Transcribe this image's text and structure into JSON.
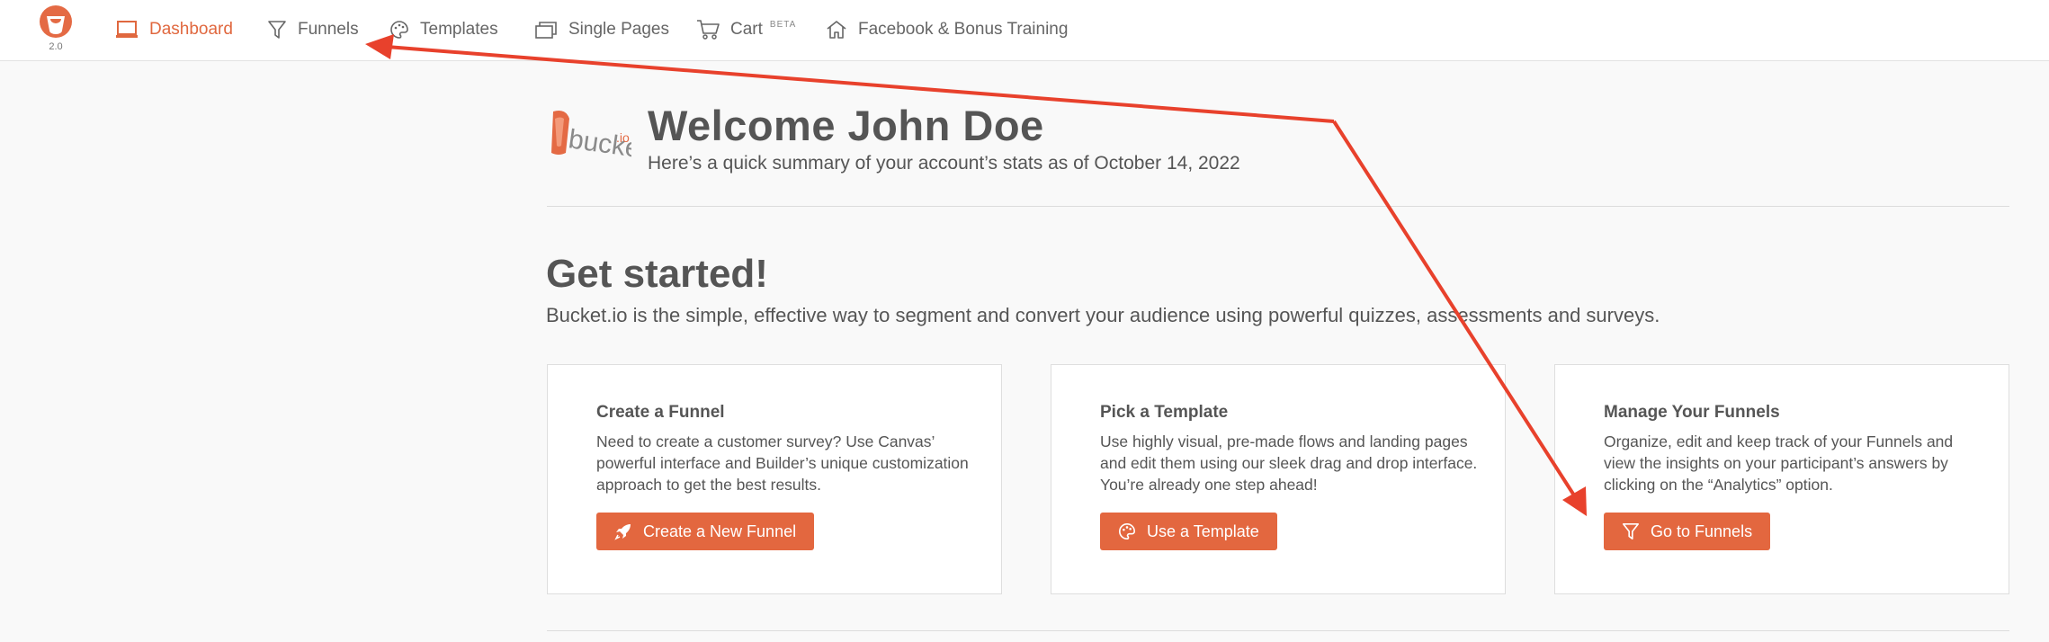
{
  "logo": {
    "version": "2.0",
    "icon": "bucket-logo-icon",
    "brand_color": "#e46a44"
  },
  "nav": {
    "items": [
      {
        "label": "Dashboard",
        "icon": "laptop-icon",
        "active": true
      },
      {
        "label": "Funnels",
        "icon": "funnel-icon"
      },
      {
        "label": "Templates",
        "icon": "palette-icon"
      },
      {
        "label": "Single Pages",
        "icon": "pages-icon"
      },
      {
        "label": "Cart",
        "icon": "cart-icon",
        "badge": "BETA"
      },
      {
        "label": "Facebook & Bonus Training",
        "icon": "home-icon"
      }
    ]
  },
  "welcome": {
    "title": "Welcome John Doe",
    "subtitle": "Here’s a quick summary of your account’s stats as of October 14, 2022"
  },
  "get_started": {
    "title": "Get started!",
    "subtitle": "Bucket.io is the simple, effective way to segment and convert your audience using powerful quizzes, assessments and surveys."
  },
  "cards": [
    {
      "title": "Create a Funnel",
      "text": "Need to create a customer survey? Use Canvas’ powerful interface and Builder’s unique customization approach to get the best results.",
      "button": "Create a New Funnel",
      "icon": "rocket-icon"
    },
    {
      "title": "Pick a Template",
      "text": "Use highly visual, pre-made flows and landing pages and edit them using our sleek drag and drop interface. You’re already one step ahead!",
      "button": "Use a Template",
      "icon": "palette-icon"
    },
    {
      "title": "Manage Your Funnels",
      "text": "Organize, edit and keep track of your Funnels and view the insights on your participant’s answers by clicking on the “Analytics” option.",
      "button": "Go to Funnels",
      "icon": "funnel-icon"
    }
  ],
  "colors": {
    "accent": "#e3673f",
    "annotation_arrow": "#e8412c"
  }
}
